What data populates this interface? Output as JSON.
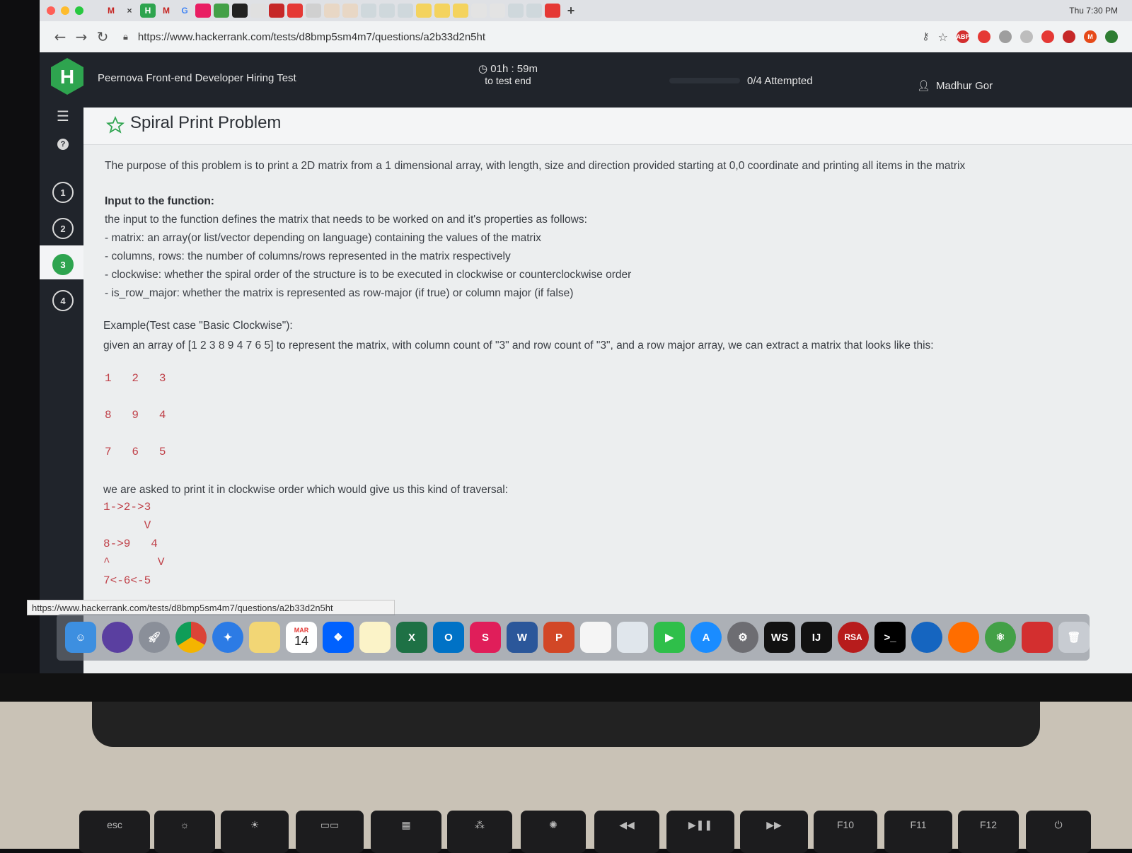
{
  "browser": {
    "url": "https://www.hackerrank.com/tests/d8bmp5sm4m7/questions/a2b33d2n5ht",
    "tabs": [
      "M",
      "×",
      "H",
      "M",
      "G"
    ],
    "clock": "Thu 7:30 PM"
  },
  "header": {
    "logo_letter": "H",
    "test_title": "Peernova Front-end Developer Hiring Test",
    "timer_value": "01h : 59m",
    "timer_caption": "to test end",
    "attempted": "0/4 Attempted",
    "user_name": "Madhur Gor"
  },
  "sidebar": {
    "questions": [
      "1",
      "2",
      "3",
      "4"
    ],
    "active_question": "3",
    "help_glyph": "?"
  },
  "problem": {
    "title": "Spiral Print Problem",
    "intro": "The purpose of this problem is to print a 2D matrix from a 1 dimensional array, with length, size and direction provided starting at 0,0 coordinate and printing all items in the matrix",
    "input_heading": "Input to the function:",
    "input_desc": "the input to the function defines the matrix that needs to be worked on and it's properties as follows:",
    "bullets": [
      "- matrix: an array(or list/vector depending on language) containing the values of the matrix",
      "- columns, rows: the number of columns/rows represented in the matrix respectively",
      "- clockwise: whether the spiral order of the structure is to be executed in clockwise or counterclockwise order",
      "- is_row_major: whether the matrix is represented as row-major (if true) or column major (if false)"
    ],
    "example_heading": "Example(Test case \"Basic Clockwise\"):",
    "example_desc": "given an array of [1 2 3 8 9 4 7 6 5]  to represent the matrix, with column count of \"3\" and row count of \"3\", and a row major array, we can extract a matrix that looks like this:",
    "matrix_rows": [
      "1   2   3",
      "8   9   4",
      "7   6   5"
    ],
    "traversal_intro": "we are asked to print it in clockwise order which would give us this kind of traversal:",
    "traversal_lines": [
      "1->2->3",
      "      V",
      "8->9   4",
      "^       V",
      "7<-6<-5"
    ]
  },
  "status_url": "https://www.hackerrank.com/tests/d8bmp5sm4m7/questions/a2b33d2n5ht",
  "dock": {
    "calendar_month": "MAR",
    "calendar_day": "14",
    "apps": [
      "X",
      "O",
      "S",
      "W",
      "P",
      "WS",
      "IJ",
      "RSA"
    ]
  },
  "keyboard": {
    "keys": [
      "esc",
      "F10",
      "F11",
      "F12"
    ]
  },
  "colors": {
    "header_bg": "#20242b",
    "active_green": "#2ea44f",
    "code_red": "#c0424a"
  }
}
